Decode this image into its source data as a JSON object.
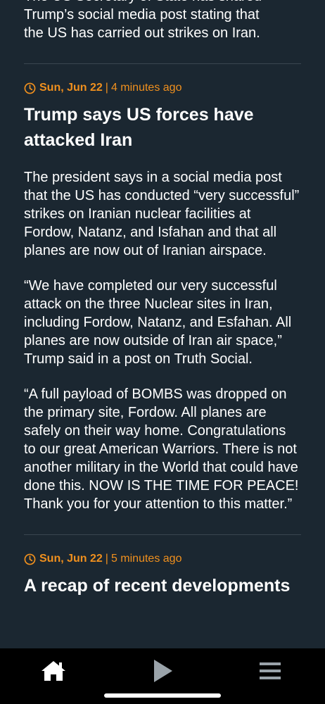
{
  "previous_entry": {
    "text_line1": "The US Secretary of State has shared",
    "text_line2": "Trump’s social media post stating that",
    "text_line3": "the US has carried out strikes on Iran."
  },
  "entries": [
    {
      "date": "Sun, Jun 22",
      "separator": "|",
      "ago": "4 minutes ago",
      "headline": "Trump says US forces have attacked Iran",
      "paragraphs": [
        "The president says in a social media post that the US has conducted “very successful” strikes on Iranian nuclear facilities at Fordow, Natanz, and Isfahan and that all planes are now out of Iranian airspace.",
        "“We have completed our very successful attack on the three Nuclear sites in Iran, including Fordow, Natanz, and Esfahan. All planes are now outside of Iran air space,” Trump said in a post on Truth Social.",
        "“A full payload of BOMBS was dropped on the primary site, Fordow. All planes are safely on their way home. Congratulations to our great American Warriors. There is not another military in the World that could have done this. NOW IS THE TIME FOR PEACE! Thank you for your attention to this matter.”"
      ]
    },
    {
      "date": "Sun, Jun 22",
      "separator": "|",
      "ago": "5 minutes ago",
      "headline": "A recap of recent developments"
    }
  ],
  "bottom_nav": {
    "items": [
      {
        "icon": "home-icon"
      },
      {
        "icon": "play-icon"
      },
      {
        "icon": "menu-icon"
      }
    ]
  },
  "colors": {
    "background": "#1b2731",
    "accent": "#f0901e",
    "text": "#ffffff",
    "nav_background": "#000000",
    "play_icon": "#9aa3aa"
  }
}
